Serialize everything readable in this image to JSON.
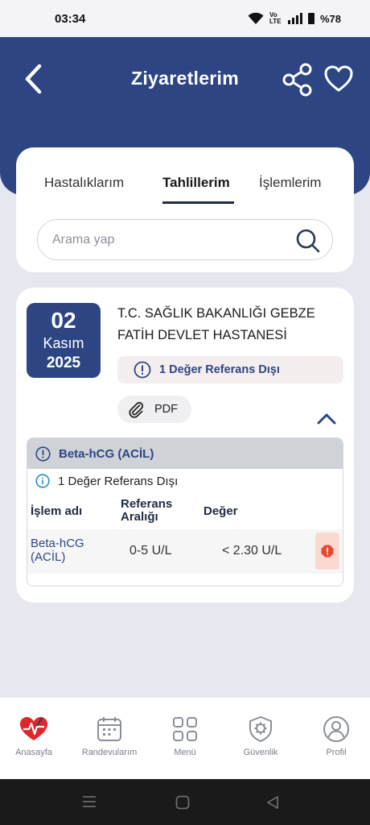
{
  "status_bar": {
    "time": "03:34",
    "lte": "Vo LTE",
    "battery": "%78"
  },
  "header": {
    "title": "Ziyaretlerim"
  },
  "tabs": [
    {
      "label": "Hastalıklarım",
      "active": false
    },
    {
      "label": "Tahlillerim",
      "active": true
    },
    {
      "label": "İşlemlerim",
      "active": false
    }
  ],
  "search": {
    "placeholder": "Arama yap",
    "value": ""
  },
  "visit": {
    "day": "02",
    "month": "Kasım",
    "year": "2025",
    "hospital": "T.C. SAĞLIK BAKANLIĞI GEBZE FATİH DEVLET HASTANESİ",
    "ref_note": "1 Değer Referans Dışı",
    "pdf_label": "PDF",
    "accent_color": "#2d4683"
  },
  "result": {
    "test_title": "Beta-hCG  (ACİL)",
    "info": "1 Değer Referans Dışı",
    "columns": {
      "name": "İşlem adı",
      "range": "Referans Aralığı",
      "value": "Değer"
    },
    "rows": [
      {
        "name": "Beta-hCG (ACİL)",
        "range": "0-5 U/L",
        "value": "< 2.30 U/L",
        "flag_icon": "warning-octagon-icon"
      }
    ],
    "flag_color": "#e9472d"
  },
  "bottom_nav": [
    {
      "label": "Anasayfa",
      "icon": "heart-logo-icon"
    },
    {
      "label": "Randevularım",
      "icon": "calendar-icon"
    },
    {
      "label": "Menü",
      "icon": "grid-icon"
    },
    {
      "label": "Güvenlik",
      "icon": "shield-gear-icon"
    },
    {
      "label": "Profil",
      "icon": "user-icon"
    }
  ]
}
